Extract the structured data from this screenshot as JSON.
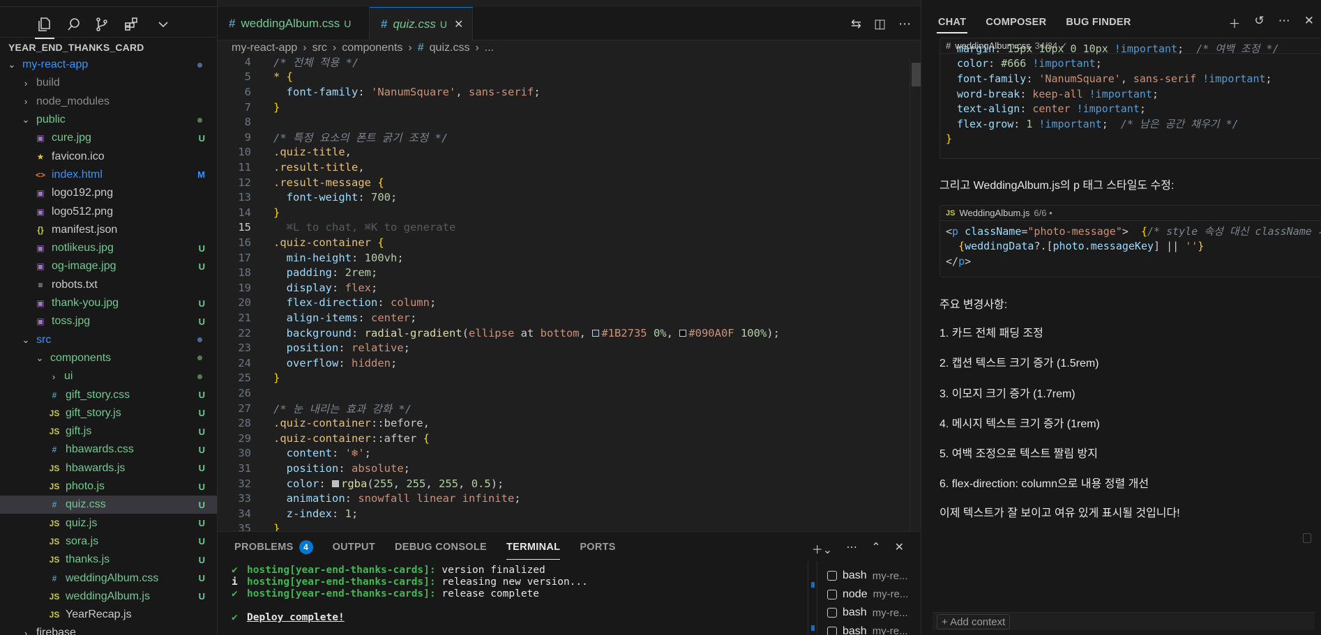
{
  "sidebar": {
    "title": "YEAR_END_THANKS_CARD",
    "icons": [
      "files-icon",
      "search-icon",
      "source-control-icon",
      "extensions-icon",
      "chevron-down-icon"
    ],
    "tree": [
      {
        "label": "my-react-app",
        "type": "folder-open",
        "depth": 0,
        "color": "#3794ff",
        "mark": "dot-blue"
      },
      {
        "label": "build",
        "type": "folder",
        "depth": 1,
        "color": "#8b8b8b",
        "mark": ""
      },
      {
        "label": "node_modules",
        "type": "folder",
        "depth": 1,
        "color": "#8b8b8b",
        "mark": ""
      },
      {
        "label": "public",
        "type": "folder-open",
        "depth": 1,
        "color": "#73c991",
        "mark": "dot"
      },
      {
        "label": "cure.jpg",
        "type": "image",
        "depth": 2,
        "color": "#73c991",
        "mark": "U"
      },
      {
        "label": "favicon.ico",
        "type": "star",
        "depth": 2,
        "color": "#cccccc",
        "mark": ""
      },
      {
        "label": "index.html",
        "type": "html",
        "depth": 2,
        "color": "#3794ff",
        "mark": "M"
      },
      {
        "label": "logo192.png",
        "type": "image",
        "depth": 2,
        "color": "#cccccc",
        "mark": ""
      },
      {
        "label": "logo512.png",
        "type": "image",
        "depth": 2,
        "color": "#cccccc",
        "mark": ""
      },
      {
        "label": "manifest.json",
        "type": "json",
        "depth": 2,
        "color": "#cccccc",
        "mark": ""
      },
      {
        "label": "notlikeus.jpg",
        "type": "image",
        "depth": 2,
        "color": "#73c991",
        "mark": "U"
      },
      {
        "label": "og-image.jpg",
        "type": "image",
        "depth": 2,
        "color": "#73c991",
        "mark": "U"
      },
      {
        "label": "robots.txt",
        "type": "text",
        "depth": 2,
        "color": "#cccccc",
        "mark": ""
      },
      {
        "label": "thank-you.jpg",
        "type": "image",
        "depth": 2,
        "color": "#73c991",
        "mark": "U"
      },
      {
        "label": "toss.jpg",
        "type": "image",
        "depth": 2,
        "color": "#73c991",
        "mark": "U"
      },
      {
        "label": "src",
        "type": "folder-open",
        "depth": 1,
        "color": "#3794ff",
        "mark": "dot-blue"
      },
      {
        "label": "components",
        "type": "folder-open",
        "depth": 2,
        "color": "#73c991",
        "mark": "dot"
      },
      {
        "label": "ui",
        "type": "folder",
        "depth": 3,
        "color": "#73c991",
        "mark": "dot"
      },
      {
        "label": "gift_story.css",
        "type": "css",
        "depth": 3,
        "color": "#73c991",
        "mark": "U"
      },
      {
        "label": "gift_story.js",
        "type": "js",
        "depth": 3,
        "color": "#73c991",
        "mark": "U"
      },
      {
        "label": "gift.js",
        "type": "js",
        "depth": 3,
        "color": "#73c991",
        "mark": "U"
      },
      {
        "label": "hbawards.css",
        "type": "css",
        "depth": 3,
        "color": "#73c991",
        "mark": "U"
      },
      {
        "label": "hbawards.js",
        "type": "js",
        "depth": 3,
        "color": "#73c991",
        "mark": "U"
      },
      {
        "label": "photo.js",
        "type": "js",
        "depth": 3,
        "color": "#73c991",
        "mark": "U"
      },
      {
        "label": "quiz.css",
        "type": "css",
        "depth": 3,
        "color": "#73c991",
        "mark": "U",
        "selected": true
      },
      {
        "label": "quiz.js",
        "type": "js",
        "depth": 3,
        "color": "#73c991",
        "mark": "U"
      },
      {
        "label": "sora.js",
        "type": "js",
        "depth": 3,
        "color": "#73c991",
        "mark": "U"
      },
      {
        "label": "thanks.js",
        "type": "js",
        "depth": 3,
        "color": "#73c991",
        "mark": "U"
      },
      {
        "label": "weddingAlbum.css",
        "type": "css",
        "depth": 3,
        "color": "#73c991",
        "mark": "U"
      },
      {
        "label": "weddingAlbum.js",
        "type": "js",
        "depth": 3,
        "color": "#73c991",
        "mark": "U"
      },
      {
        "label": "YearRecap.js",
        "type": "js",
        "depth": 3,
        "color": "#cccccc",
        "mark": ""
      },
      {
        "label": "firebase",
        "type": "folder",
        "depth": 1,
        "color": "#cccccc",
        "mark": ""
      }
    ]
  },
  "editor": {
    "tabs": [
      {
        "icon": "#",
        "name": "weddingAlbum.css",
        "status": "U",
        "active": false
      },
      {
        "icon": "#",
        "name": "quiz.css",
        "status": "U",
        "active": true,
        "close": "✕"
      }
    ],
    "breadcrumb": [
      "my-react-app",
      "src",
      "components",
      "quiz.css",
      "..."
    ],
    "current_line": 15,
    "lines": [
      {
        "n": 4,
        "tokens": [
          [
            "/* 전체 적용 */",
            "com"
          ]
        ]
      },
      {
        "n": 5,
        "tokens": [
          [
            "* ",
            "sel"
          ],
          [
            "{",
            "brace"
          ]
        ]
      },
      {
        "n": 6,
        "tokens": [
          [
            "  font-family",
            "prop"
          ],
          [
            ": ",
            "pun"
          ],
          [
            "'NanumSquare'",
            "str"
          ],
          [
            ", ",
            "pun"
          ],
          [
            "sans-serif",
            "val"
          ],
          [
            ";",
            "pun"
          ]
        ]
      },
      {
        "n": 7,
        "tokens": [
          [
            "}",
            "brace"
          ]
        ]
      },
      {
        "n": 8,
        "tokens": []
      },
      {
        "n": 9,
        "tokens": [
          [
            "/* 특정 요소의 폰트 굵기 조정 */",
            "com"
          ]
        ]
      },
      {
        "n": 10,
        "tokens": [
          [
            ".quiz-title",
            "sel"
          ],
          [
            ",",
            "pun"
          ]
        ]
      },
      {
        "n": 11,
        "tokens": [
          [
            ".result-title",
            "sel"
          ],
          [
            ",",
            "pun"
          ]
        ]
      },
      {
        "n": 12,
        "tokens": [
          [
            ".result-message ",
            "sel"
          ],
          [
            "{",
            "brace"
          ]
        ]
      },
      {
        "n": 13,
        "tokens": [
          [
            "  font-weight",
            "prop"
          ],
          [
            ": ",
            "pun"
          ],
          [
            "700",
            "num"
          ],
          [
            ";",
            "pun"
          ]
        ]
      },
      {
        "n": 14,
        "tokens": [
          [
            "}",
            "brace"
          ]
        ]
      },
      {
        "n": 15,
        "tokens": [
          [
            "  ⌘L to chat, ⌘K to generate",
            "hint"
          ]
        ]
      },
      {
        "n": 16,
        "tokens": [
          [
            ".quiz-container ",
            "sel"
          ],
          [
            "{",
            "brace"
          ]
        ]
      },
      {
        "n": 17,
        "tokens": [
          [
            "  min-height",
            "prop"
          ],
          [
            ": ",
            "pun"
          ],
          [
            "100vh",
            "num"
          ],
          [
            ";",
            "pun"
          ]
        ]
      },
      {
        "n": 18,
        "tokens": [
          [
            "  padding",
            "prop"
          ],
          [
            ": ",
            "pun"
          ],
          [
            "2rem",
            "num"
          ],
          [
            ";",
            "pun"
          ]
        ]
      },
      {
        "n": 19,
        "tokens": [
          [
            "  display",
            "prop"
          ],
          [
            ": ",
            "pun"
          ],
          [
            "flex",
            "val"
          ],
          [
            ";",
            "pun"
          ]
        ]
      },
      {
        "n": 20,
        "tokens": [
          [
            "  flex-direction",
            "prop"
          ],
          [
            ": ",
            "pun"
          ],
          [
            "column",
            "val"
          ],
          [
            ";",
            "pun"
          ]
        ]
      },
      {
        "n": 21,
        "tokens": [
          [
            "  align-items",
            "prop"
          ],
          [
            ": ",
            "pun"
          ],
          [
            "center",
            "val"
          ],
          [
            ";",
            "pun"
          ]
        ]
      },
      {
        "n": 22,
        "tokens": [
          [
            "  background",
            "prop"
          ],
          [
            ": ",
            "pun"
          ],
          [
            "radial-gradient",
            "fn"
          ],
          [
            "(",
            "pun"
          ],
          [
            "ellipse",
            "val"
          ],
          [
            " at ",
            "pun"
          ],
          [
            "bottom",
            "val"
          ],
          [
            ", ",
            "pun"
          ],
          [
            "■",
            "swatch:#1B2735"
          ],
          [
            "#1B2735 ",
            "val"
          ],
          [
            "0%",
            "num"
          ],
          [
            ", ",
            "pun"
          ],
          [
            "■",
            "swatch:#090A0F"
          ],
          [
            "#090A0F ",
            "val"
          ],
          [
            "100%",
            "num"
          ],
          [
            ");",
            "pun"
          ]
        ]
      },
      {
        "n": 23,
        "tokens": [
          [
            "  position",
            "prop"
          ],
          [
            ": ",
            "pun"
          ],
          [
            "relative",
            "val"
          ],
          [
            ";",
            "pun"
          ]
        ]
      },
      {
        "n": 24,
        "tokens": [
          [
            "  overflow",
            "prop"
          ],
          [
            ": ",
            "pun"
          ],
          [
            "hidden",
            "val"
          ],
          [
            ";",
            "pun"
          ]
        ]
      },
      {
        "n": 25,
        "tokens": [
          [
            "}",
            "brace"
          ]
        ]
      },
      {
        "n": 26,
        "tokens": []
      },
      {
        "n": 27,
        "tokens": [
          [
            "/* 눈 내리는 효과 강화 */",
            "com"
          ]
        ]
      },
      {
        "n": 28,
        "tokens": [
          [
            ".quiz-container",
            "sel"
          ],
          [
            "::before",
            "pun"
          ],
          [
            ",",
            "pun"
          ]
        ]
      },
      {
        "n": 29,
        "tokens": [
          [
            ".quiz-container",
            "sel"
          ],
          [
            "::after ",
            "pun"
          ],
          [
            "{",
            "brace"
          ]
        ]
      },
      {
        "n": 30,
        "tokens": [
          [
            "  content",
            "prop"
          ],
          [
            ": ",
            "pun"
          ],
          [
            "'❄'",
            "str"
          ],
          [
            ";",
            "pun"
          ]
        ]
      },
      {
        "n": 31,
        "tokens": [
          [
            "  position",
            "prop"
          ],
          [
            ": ",
            "pun"
          ],
          [
            "absolute",
            "val"
          ],
          [
            ";",
            "pun"
          ]
        ]
      },
      {
        "n": 32,
        "tokens": [
          [
            "  color",
            "prop"
          ],
          [
            ": ",
            "pun"
          ],
          [
            "■",
            "swatch:#bdbdbd"
          ],
          [
            "rgba",
            "fn"
          ],
          [
            "(",
            "pun"
          ],
          [
            "255",
            "num"
          ],
          [
            ", ",
            "pun"
          ],
          [
            "255",
            "num"
          ],
          [
            ", ",
            "pun"
          ],
          [
            "255",
            "num"
          ],
          [
            ", ",
            "pun"
          ],
          [
            "0.5",
            "num"
          ],
          [
            ");",
            "pun"
          ]
        ]
      },
      {
        "n": 33,
        "tokens": [
          [
            "  animation",
            "prop"
          ],
          [
            ": ",
            "pun"
          ],
          [
            "snowfall linear infinite",
            "val"
          ],
          [
            ";",
            "pun"
          ]
        ]
      },
      {
        "n": 34,
        "tokens": [
          [
            "  z-index",
            "prop"
          ],
          [
            ": ",
            "pun"
          ],
          [
            "1",
            "num"
          ],
          [
            ";",
            "pun"
          ]
        ]
      },
      {
        "n": 35,
        "tokens": [
          [
            "}",
            "brace"
          ]
        ]
      }
    ]
  },
  "panel": {
    "tabs": [
      {
        "label": "PROBLEMS",
        "badge": "4"
      },
      {
        "label": "OUTPUT"
      },
      {
        "label": "DEBUG CONSOLE"
      },
      {
        "label": "TERMINAL",
        "active": true
      },
      {
        "label": "PORTS"
      }
    ],
    "terminal_lines": [
      {
        "mark": "✔",
        "host": "hosting[year-end-thanks-cards]:",
        "msg": " version finalized"
      },
      {
        "mark": "i",
        "host": "hosting[year-end-thanks-cards]:",
        "msg": " releasing new version..."
      },
      {
        "mark": "✔",
        "host": "hosting[year-end-thanks-cards]:",
        "msg": " release complete"
      },
      {
        "mark": "",
        "host": "",
        "msg": ""
      },
      {
        "mark": "✔",
        "host": "",
        "msg": "Deploy complete!",
        "deploy": true
      }
    ],
    "terminals": [
      {
        "name": "bash",
        "detail": "my-re..."
      },
      {
        "name": "node",
        "detail": "my-re..."
      },
      {
        "name": "bash",
        "detail": "my-re..."
      },
      {
        "name": "bash",
        "detail": "my-re..."
      }
    ]
  },
  "chat": {
    "tabs": [
      "CHAT",
      "COMPOSER",
      "BUG FINDER"
    ],
    "block1": {
      "file": "weddingAlbum.css",
      "meta": "34/34 ✓",
      "lines": [
        [
          [
            "margin",
            "prop"
          ],
          [
            ": ",
            "pun"
          ],
          [
            "15px 10px 0 10px ",
            "num"
          ],
          [
            "!important",
            "imp"
          ],
          [
            ";  ",
            "pun"
          ],
          [
            "/* 여백 조정 */",
            "com"
          ]
        ],
        [
          [
            "color",
            "prop"
          ],
          [
            ": ",
            "pun"
          ],
          [
            "#666 ",
            "num"
          ],
          [
            "!important",
            "imp"
          ],
          [
            ";",
            "pun"
          ]
        ],
        [
          [
            "font-family",
            "prop"
          ],
          [
            ": ",
            "pun"
          ],
          [
            "'NanumSquare'",
            "str"
          ],
          [
            ", ",
            "pun"
          ],
          [
            "sans-serif ",
            "val"
          ],
          [
            "!important",
            "imp"
          ],
          [
            ";",
            "pun"
          ]
        ],
        [
          [
            "word-break",
            "prop"
          ],
          [
            ": ",
            "pun"
          ],
          [
            "keep-all ",
            "val"
          ],
          [
            "!important",
            "imp"
          ],
          [
            ";",
            "pun"
          ]
        ],
        [
          [
            "text-align",
            "prop"
          ],
          [
            ": ",
            "pun"
          ],
          [
            "center ",
            "val"
          ],
          [
            "!important",
            "imp"
          ],
          [
            ";",
            "pun"
          ]
        ],
        [
          [
            "flex-grow",
            "prop"
          ],
          [
            ": ",
            "pun"
          ],
          [
            "1 ",
            "num"
          ],
          [
            "!important",
            "imp"
          ],
          [
            ";  ",
            "pun"
          ],
          [
            "/* 남은 공간 채우기 */",
            "com"
          ]
        ]
      ],
      "closing": "}"
    },
    "intro": "그리고 WeddingAlbum.js의 p 태그 스타일도 수정:",
    "block2": {
      "file": "WeddingAlbum.js",
      "meta": "6/6 •",
      "lines": [
        [
          [
            "<",
            "pun"
          ],
          [
            "p ",
            "tag"
          ],
          [
            "className",
            "attr"
          ],
          [
            "=",
            "pun"
          ],
          [
            "\"photo-message\"",
            "str"
          ],
          [
            ">  ",
            "pun"
          ],
          [
            "{",
            "brace"
          ],
          [
            "/* style 속성 대신 className 사",
            "com"
          ]
        ],
        [
          [
            "  {",
            "brace"
          ],
          [
            "weddingData",
            "prop"
          ],
          [
            "?.",
            "pun"
          ],
          [
            "[",
            "pun"
          ],
          [
            "photo",
            "prop"
          ],
          [
            ".",
            "pun"
          ],
          [
            "messageKey",
            "prop"
          ],
          [
            "]",
            "pun"
          ],
          [
            " || ",
            "pun"
          ],
          [
            "''",
            "str"
          ],
          [
            "}",
            "brace"
          ]
        ],
        [
          [
            "</",
            "pun"
          ],
          [
            "p",
            "tag"
          ],
          [
            ">",
            "pun"
          ]
        ]
      ]
    },
    "changes_title": "주요 변경사항:",
    "changes": [
      "1. 카드 전체 패딩 조정",
      "2. 캡션 텍스트 크기 증가 (1.5rem)",
      "3. 이모지 크기 증가 (1.7rem)",
      "4. 메시지 텍스트 크기 증가 (1rem)",
      "5. 여백 조정으로 텍스트 짤림 방지",
      "6. flex-direction: column으로 내용 정렬 개선"
    ],
    "conclusion": "이제 텍스트가 잘 보이고 여유 있게 표시될 것입니다!",
    "add_context": "+ Add context"
  }
}
